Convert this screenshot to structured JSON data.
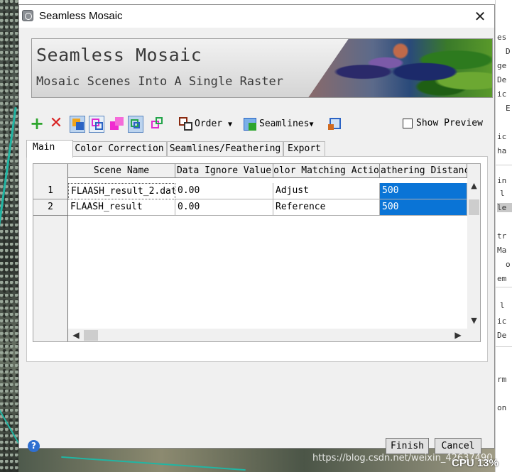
{
  "window": {
    "title": "Seamless Mosaic",
    "close_glyph": "✕"
  },
  "banner": {
    "title": "Seamless Mosaic",
    "subtitle": "Mosaic Scenes Into A Single Raster"
  },
  "toolbar": {
    "add_icon": "plus-icon",
    "remove_icon": "remove-x-icon",
    "order_label": "Order",
    "seamlines_label": "Seamlines",
    "show_preview_label": "Show Preview",
    "show_preview_checked": false,
    "caret": "▼"
  },
  "tabs": [
    {
      "label": "Main",
      "active": true
    },
    {
      "label": "Color Correction",
      "active": false
    },
    {
      "label": "Seamlines/Feathering",
      "active": false
    },
    {
      "label": "Export",
      "active": false
    }
  ],
  "table": {
    "columns": [
      "Scene Name",
      "Data Ignore Value",
      "olor Matching Actio",
      "athering Distanc"
    ],
    "rows": [
      {
        "num": "1",
        "scene": "FLAASH_result_2.dat",
        "ignore": "0.00",
        "action": "Adjust",
        "distance": "500"
      },
      {
        "num": "2",
        "scene": "FLAASH_result",
        "ignore": "0.00",
        "action": "Reference",
        "distance": "500"
      }
    ]
  },
  "footer": {
    "help": "?",
    "finish_label": "Finish",
    "cancel_label": "Cancel"
  },
  "overlay": {
    "watermark": "https://blog.csdn.net/weixin_42637490",
    "cpu": "CPU 13%"
  },
  "background_text": [
    "es",
    "D",
    "ge",
    "De",
    "ic",
    "E",
    "ic",
    "ha",
    "in",
    "l",
    "le",
    "tr",
    "Ma",
    "o",
    "em",
    "l",
    "ic",
    "De",
    "rm",
    "on"
  ],
  "colors": {
    "selection": "#0a74d6",
    "add": "#2da52d",
    "remove": "#d82020"
  }
}
